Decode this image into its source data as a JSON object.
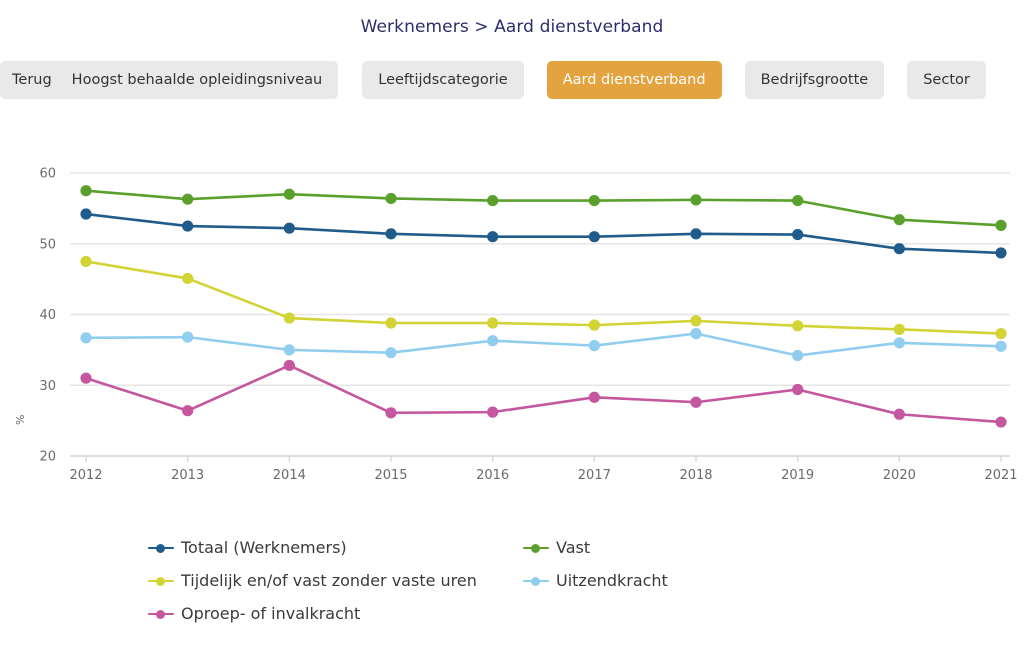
{
  "header": {
    "title": "Werknemers > Aard dienstverband"
  },
  "toolbar": {
    "back_label": "Terug",
    "buttons": [
      {
        "label": "Hoogst behaalde opleidingsniveau",
        "active": false
      },
      {
        "label": "Leeftijdscategorie",
        "active": false
      },
      {
        "label": "Aard dienstverband",
        "active": true
      },
      {
        "label": "Bedrijfsgrootte",
        "active": false
      },
      {
        "label": "Sector",
        "active": false
      }
    ],
    "active_color": "#e3a33f",
    "inactive_color": "#e9e9e9"
  },
  "chart_data": {
    "type": "line",
    "title": "Werknemers > Aard dienstverband",
    "xlabel": "",
    "ylabel": "%",
    "categories": [
      "2012",
      "2013",
      "2014",
      "2015",
      "2016",
      "2017",
      "2018",
      "2019",
      "2020",
      "2021"
    ],
    "x": [
      2012,
      2013,
      2014,
      2015,
      2016,
      2017,
      2018,
      2019,
      2020,
      2021
    ],
    "ylim": [
      20,
      60
    ],
    "yticks": [
      20,
      30,
      40,
      50,
      60
    ],
    "grid": true,
    "legend_position": "bottom",
    "series": [
      {
        "name": "Totaal (Werknemers)",
        "color": "#1f5c8b",
        "values": [
          54.2,
          52.5,
          52.2,
          51.4,
          51.0,
          51.0,
          51.4,
          51.3,
          49.3,
          48.7
        ]
      },
      {
        "name": "Vast",
        "color": "#5aa02c",
        "values": [
          57.5,
          56.3,
          57.0,
          56.4,
          56.1,
          56.1,
          56.2,
          56.1,
          53.4,
          52.6
        ]
      },
      {
        "name": "Tijdelijk en/of vast zonder vaste uren",
        "color": "#d2d335",
        "values": [
          47.5,
          45.1,
          39.5,
          38.8,
          38.8,
          38.5,
          39.1,
          38.4,
          37.9,
          37.3
        ]
      },
      {
        "name": "Uitzendkracht",
        "color": "#90cdee",
        "values": [
          36.7,
          36.8,
          35.0,
          34.6,
          36.3,
          35.6,
          37.3,
          34.2,
          36.0,
          35.5
        ]
      },
      {
        "name": "Oproep- of invalkracht",
        "color": "#c4579f",
        "values": [
          31.0,
          26.4,
          32.8,
          26.1,
          26.2,
          28.3,
          27.6,
          29.4,
          25.9,
          24.8
        ]
      }
    ]
  }
}
